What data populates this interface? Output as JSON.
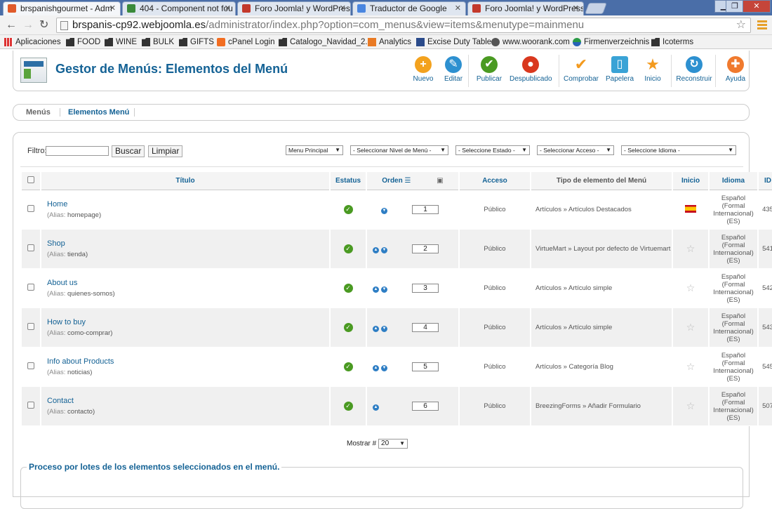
{
  "browser": {
    "tabs": [
      {
        "title": "brspanishgourmet - Adm",
        "active": true
      },
      {
        "title": "404 - Component not fou",
        "active": false
      },
      {
        "title": "Foro Joomla! y WordPress",
        "active": false
      },
      {
        "title": "Traductor de Google",
        "active": false
      },
      {
        "title": "Foro Joomla! y WordPress",
        "active": false
      }
    ],
    "url_host": "brspanis-cp92.webjoomla.es",
    "url_path": "/administrator/index.php?option=com_menus&view=items&menutype=mainmenu",
    "bookmarks": [
      "Aplicaciones",
      "FOOD",
      "WINE",
      "BULK",
      "GIFTS",
      "cPanel Login",
      "Catalogo_Navidad_2...",
      "Analytics",
      "Excise Duty Table",
      "www.woorank.com",
      "Firmenverzeichnis",
      "Icoterms"
    ]
  },
  "header": {
    "title": "Gestor de Menús: Elementos del Menú",
    "toolbar": [
      {
        "label": "Nuevo",
        "color": "#f3a21e",
        "glyph": "+"
      },
      {
        "label": "Editar",
        "color": "#2d90d0",
        "glyph": "✎"
      },
      {
        "label": "Publicar",
        "color": "#4a9a22",
        "glyph": "✔"
      },
      {
        "label": "Despublicado",
        "color": "#d9381e",
        "glyph": "●"
      },
      {
        "label": "Comprobar",
        "color": "#f39a1e",
        "glyph": "✔"
      },
      {
        "label": "Papelera",
        "color": "#3aa3d6",
        "glyph": "▯"
      },
      {
        "label": "Inicio",
        "color": "#f39a1e",
        "glyph": "★"
      },
      {
        "label": "Reconstruir",
        "color": "#2d90d0",
        "glyph": "↻"
      },
      {
        "label": "Ayuda",
        "color": "#f07a2e",
        "glyph": "✚"
      }
    ]
  },
  "subnav": {
    "items": [
      "Menús",
      "Elementos Menú"
    ]
  },
  "filter": {
    "label": "Filtro:",
    "value": "",
    "search_label": "Buscar",
    "clear_label": "Limpiar",
    "menu_select": "Menu Principal",
    "level_select": "- Seleccionar Nivel de Menú -",
    "state_select": "- Seleccione Estado -",
    "access_select": "- Seleccionar Acceso -",
    "language_select": "- Seleccione Idioma -"
  },
  "table": {
    "headers": {
      "title": "Título",
      "status": "Estatus",
      "order": "Orden",
      "access": "Acceso",
      "type": "Tipo de elemento del Menú",
      "home": "Inicio",
      "language": "Idioma",
      "id": "ID"
    },
    "alias_prefix": "(Alias:",
    "rows": [
      {
        "title": "Home",
        "alias": "homepage",
        "order": "1",
        "access": "Público",
        "type": "Artículos » Artículos Destacados",
        "home": true,
        "language": "Español (Formal Internacional) (ES)",
        "id": "435",
        "up": false,
        "down": true
      },
      {
        "title": "Shop",
        "alias": "tienda",
        "order": "2",
        "access": "Público",
        "type": "VirtueMart » Layout por defecto de Virtuemart",
        "home": false,
        "language": "Español (Formal Internacional) (ES)",
        "id": "541",
        "up": true,
        "down": true
      },
      {
        "title": "About us",
        "alias": "quienes-somos",
        "order": "3",
        "access": "Público",
        "type": "Artículos » Artículo simple",
        "home": false,
        "language": "Español (Formal Internacional) (ES)",
        "id": "542",
        "up": true,
        "down": true
      },
      {
        "title": "How to buy",
        "alias": "como-comprar",
        "order": "4",
        "access": "Público",
        "type": "Artículos » Artículo simple",
        "home": false,
        "language": "Español (Formal Internacional) (ES)",
        "id": "543",
        "up": true,
        "down": true
      },
      {
        "title": "Info about Products",
        "alias": "noticias",
        "order": "5",
        "access": "Público",
        "type": "Artículos » Categoría Blog",
        "home": false,
        "language": "Español (Formal Internacional) (ES)",
        "id": "545",
        "up": true,
        "down": true
      },
      {
        "title": "Contact",
        "alias": "contacto",
        "order": "6",
        "access": "Público",
        "type": "BreezingForms » Añadir Formulario",
        "home": false,
        "language": "Español (Formal Internacional) (ES)",
        "id": "507",
        "up": true,
        "down": false
      }
    ]
  },
  "pager": {
    "label": "Mostrar #",
    "value": "20"
  },
  "batch": {
    "legend": "Proceso por lotes de los elementos seleccionados en el menú."
  }
}
